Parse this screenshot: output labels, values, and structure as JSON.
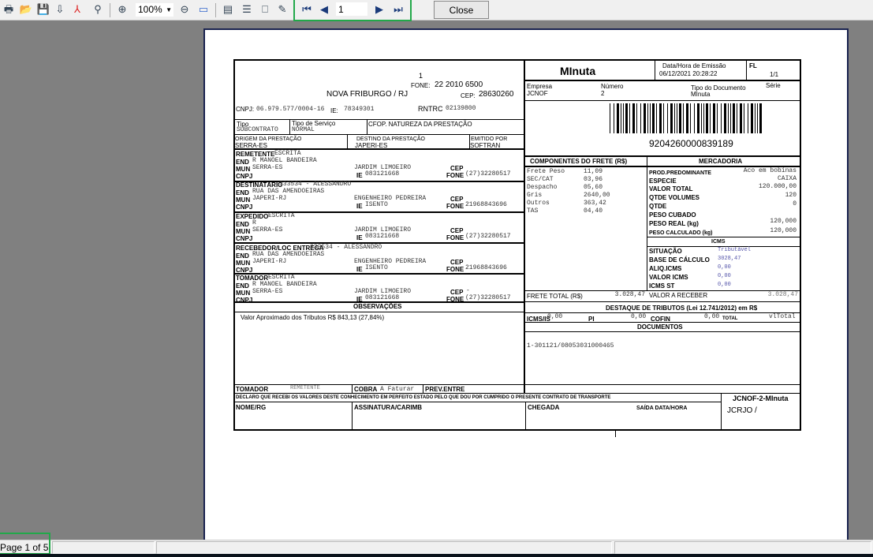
{
  "toolbar": {
    "icons": [
      "print-icon",
      "open-icon",
      "save-icon",
      "export-icon",
      "pdf-icon",
      "find-icon",
      "zoom-in-icon",
      "zoom-out-icon",
      "page-width-icon",
      "single-page-icon",
      "multi-page-icon",
      "book-icon",
      "edit-icon"
    ],
    "zoom": "100%",
    "nav_icons": [
      "first-page-icon",
      "prev-page-icon",
      "next-page-icon",
      "last-page-icon"
    ],
    "page": "1",
    "close": "Close"
  },
  "status": {
    "page_count": "Page 1 of 5"
  },
  "doc": {
    "hdr": {
      "num": "1",
      "fone_l": "FONE:",
      "fone": "22 2010 6500",
      "city": "NOVA FRIBURGO / RJ",
      "cep_l": "CEP:",
      "cep": "28630260",
      "cnpj_l": "CNPJ:",
      "cnpj": "06.979.577/0004-16",
      "ie_l": "IE:",
      "ie": "78349301",
      "rntrc_l": "RNTRC",
      "rntrc": "02139800"
    },
    "tipo": {
      "tipo_l": "Tipo",
      "tipo": "SUBCONTRATO",
      "serv_l": "Tipo de Serviço",
      "serv": "NORMAL",
      "cfop_l": "CFOP. NATUREZA DA PRESTAÇÃO"
    },
    "origem": {
      "orig_l": "ORIGEM DA PRESTAÇÃO",
      "orig": "SERRA-ES",
      "dest_l": "DESTINO DA PRESTAÇÃO",
      "dest": "JAPERI-ES",
      "emit_l": "EMITIDO POR",
      "emit": "SOFTRAN"
    },
    "labels": {
      "end": "END",
      "mun": "MUN",
      "cnpj": "CNPJ",
      "ie": "IE",
      "cep": "CEP",
      "fone": "FONE"
    },
    "parties": [
      {
        "label": "REMETENTE",
        "name": "ESCRITA",
        "end": "R MANOEL BANDEIRA",
        "mun": "SERRA-ES",
        "bairro": "JARDIM LIMOEIRO",
        "ie": "083121668",
        "cep": "",
        "fone": "(27)32280517"
      },
      {
        "label": "DESTINATÁRIO",
        "name": "333534 - ALESSANDRO",
        "end": "RUA DAS AMENDOEIRAS",
        "mun": "JAPERI-RJ",
        "bairro": "ENGENHEIRO PEDREIRA",
        "ie": "ISENTO",
        "cep": "",
        "fone": "21968843696"
      },
      {
        "label": "EXPEDIDO",
        "name": "ESCRITA",
        "end": "R",
        "mun": "SERRA-ES",
        "bairro": "JARDIM LIMOEIRO",
        "ie": "083121668",
        "cep": "",
        "fone": "(27)32280517"
      },
      {
        "label": "RECEBEDOR/LOC ENTREGA",
        "name": "333534 - ALESSANDRO",
        "end": "RUA DAS AMENDOEIRAS",
        "mun": "JAPERI-RJ",
        "bairro": "ENGENHEIRO PEDREIRA",
        "ie": "ISENTO",
        "cep": "",
        "fone": "21968843696"
      },
      {
        "label": "TOMADOR",
        "name": "ESCRITA",
        "end": "R MANOEL BANDEIRA",
        "mun": "SERRA-ES",
        "bairro": "JARDIM LIMOEIRO",
        "ie": "083121668",
        "cep": "-",
        "fone": "(27)32280517"
      }
    ],
    "obs": {
      "title": "OBSERVAÇÕES",
      "text": "Valor Aproximado dos Tributos R$ 843,13 (27,84%)"
    },
    "bottom": {
      "tom_l": "TOMADOR",
      "tom": "REMETENTE",
      "cobra_l": "COBRA",
      "cobra": "A Faturar",
      "prev_l": "PREV.ENTRE",
      "declaro": "DECLARO QUE RECEBI OS VALORES DESTE CONHECIMENTO EM PERFEITO ESTADO PELO QUE DOU POR CUMPRIDO O PRESENTE CONTRATO DE TRANSPORTE",
      "nome": "NOME/RG",
      "assin": "ASSINATURA/CARIMB",
      "cheg": "CHEGADA",
      "saida": "SAÍDA DATA/HORA",
      "ref": "JCNOF-2-MInuta",
      "filial": "JCRJO /"
    },
    "right": {
      "title": "MInuta",
      "emis_l": "Data/Hora de Emissão",
      "emis": "06/12/2021 20:28:22",
      "fl_l": "FL",
      "fl": "1/1",
      "emp_l": "Empresa",
      "emp": "JCNOF",
      "num_l": "Número",
      "num": "2",
      "tipo_l": "Tipo do Documento",
      "tipo": "MInuta",
      "serie_l": "Série",
      "barcode": "9204260000839189"
    },
    "comp": {
      "title": "COMPONENTES DO FRETE (R$)",
      "items": [
        {
          "k": "Frete Peso",
          "v": "11,09"
        },
        {
          "k": "SEC/CAT",
          "v": "03,96"
        },
        {
          "k": "Despacho",
          "v": "05,60"
        },
        {
          "k": "Gris",
          "v": "2640,00"
        },
        {
          "k": "Outros",
          "v": "363,42"
        },
        {
          "k": "TAS",
          "v": "04,40"
        }
      ],
      "total_l": "FRETE TOTAL (R$)",
      "total": "3.028,47"
    },
    "merc": {
      "title": "MERCADORIA",
      "items": [
        {
          "k": "PROD.PREDOMINANTE",
          "v": "Aco em bobinas"
        },
        {
          "k": "ESPECIE",
          "v": "CAIXA"
        },
        {
          "k": "VALOR TOTAL",
          "v": "120.000,00"
        },
        {
          "k": "QTDE VOLUMES",
          "v": "120"
        },
        {
          "k": "QTDE",
          "v": "0"
        },
        {
          "k": "PESO CUBADO",
          "v": ""
        },
        {
          "k": "PESO REAL (kg)",
          "v": "120,000"
        },
        {
          "k": "PESO CALCULADO (kg)",
          "v": "120,000"
        }
      ],
      "receber_l": "VALOR A RECEBER",
      "receber": "3.028,47"
    },
    "icms": {
      "title": "ICMS",
      "items": [
        {
          "k": "SITUAÇÃO",
          "v": "Tributável"
        },
        {
          "k": "BASE DE CÁLCULO",
          "v": "3028,47"
        },
        {
          "k": "ALIQ.ICMS",
          "v": "0,00"
        },
        {
          "k": "VALOR ICMS",
          "v": "0,00"
        },
        {
          "k": "ICMS ST",
          "v": "0,00"
        }
      ]
    },
    "trib": {
      "title": "DESTAQUE DE TRIBUTOS (Lei 12.741/2012) em R$",
      "icms_l": "ICMS/IS",
      "icms": "0,00",
      "pi_l": "PI",
      "pi": "0,00",
      "cofin_l": "COFIN",
      "cofin": "0,00",
      "total_l": "TOTAL",
      "total": "vlTotal"
    },
    "docs": {
      "title": "DOCUMENTOS",
      "item": "1-301121/08053031000465"
    }
  }
}
